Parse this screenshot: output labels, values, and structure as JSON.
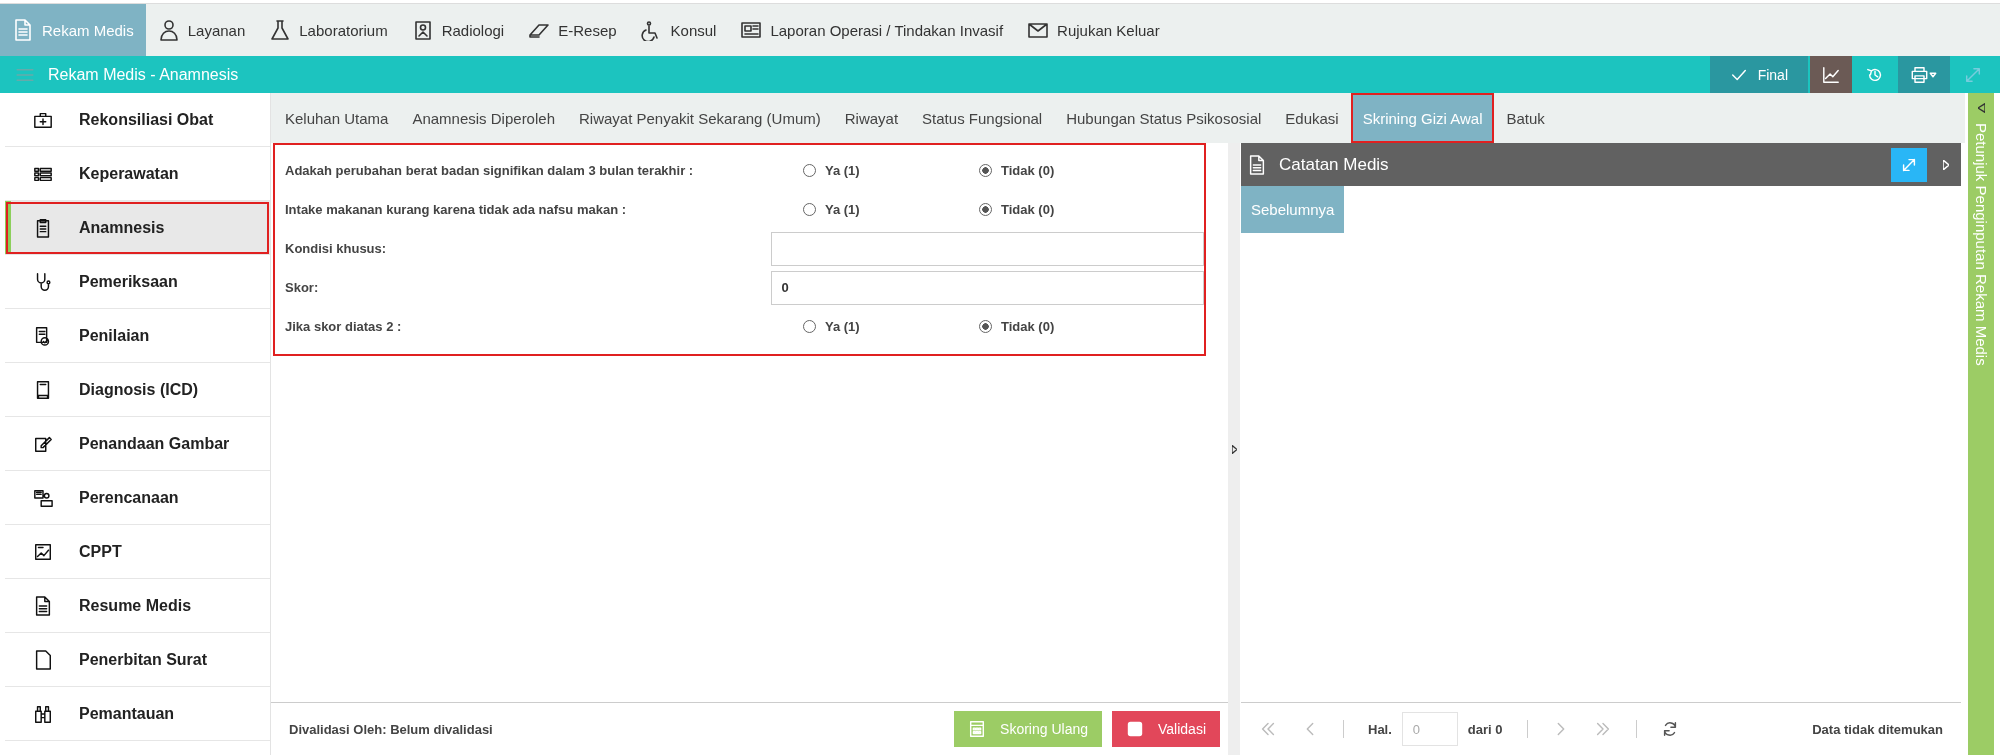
{
  "nav": [
    {
      "label": "Rekam Medis",
      "selected": true
    },
    {
      "label": "Layanan",
      "selected": false
    },
    {
      "label": "Laboratorium",
      "selected": false
    },
    {
      "label": "Radiologi",
      "selected": false
    },
    {
      "label": "E-Resep",
      "selected": false
    },
    {
      "label": "Konsul",
      "selected": false
    },
    {
      "label": "Laporan Operasi / Tindakan Invasif",
      "selected": false
    },
    {
      "label": "Rujukan Keluar",
      "selected": false
    }
  ],
  "header": {
    "title": "Rekam Medis - Anamnesis",
    "final_button": "Final"
  },
  "sidebar": {
    "items": [
      {
        "label": "Rekonsiliasi Obat",
        "selected": false
      },
      {
        "label": "Keperawatan",
        "selected": false
      },
      {
        "label": "Anamnesis",
        "selected": true
      },
      {
        "label": "Pemeriksaan",
        "selected": false
      },
      {
        "label": "Penilaian",
        "selected": false
      },
      {
        "label": "Diagnosis (ICD)",
        "selected": false
      },
      {
        "label": "Penandaan Gambar",
        "selected": false
      },
      {
        "label": "Perencanaan",
        "selected": false
      },
      {
        "label": "CPPT",
        "selected": false
      },
      {
        "label": "Resume Medis",
        "selected": false
      },
      {
        "label": "Penerbitan Surat",
        "selected": false
      },
      {
        "label": "Pemantauan",
        "selected": false
      }
    ]
  },
  "tabs": [
    {
      "label": "Keluhan Utama",
      "selected": false
    },
    {
      "label": "Anamnesis Diperoleh",
      "selected": false
    },
    {
      "label": "Riwayat Penyakit Sekarang (Umum)",
      "selected": false
    },
    {
      "label": "Riwayat",
      "selected": false
    },
    {
      "label": "Status Fungsional",
      "selected": false
    },
    {
      "label": "Hubungan Status Psikososial",
      "selected": false
    },
    {
      "label": "Edukasi",
      "selected": false
    },
    {
      "label": "Skrining Gizi Awal",
      "selected": true
    },
    {
      "label": "Batuk",
      "selected": false
    }
  ],
  "form": {
    "rows": [
      {
        "kind": "radio",
        "label": "Adakah perubahan berat badan signifikan dalam 3 bulan terakhir :",
        "options": [
          {
            "label": "Ya (1)",
            "selected": false
          },
          {
            "label": "Tidak (0)",
            "selected": true
          }
        ]
      },
      {
        "kind": "radio",
        "label": "Intake makanan kurang karena tidak ada nafsu makan :",
        "options": [
          {
            "label": "Ya (1)",
            "selected": false
          },
          {
            "label": "Tidak (0)",
            "selected": true
          }
        ]
      },
      {
        "kind": "text",
        "label": "Kondisi khusus:",
        "value": ""
      },
      {
        "kind": "text",
        "label": "Skor:",
        "value": "0"
      },
      {
        "kind": "radio",
        "label": "Jika skor diatas 2 :",
        "options": [
          {
            "label": "Ya (1)",
            "selected": false
          },
          {
            "label": "Tidak (0)",
            "selected": true
          }
        ]
      }
    ]
  },
  "footer": {
    "status": "Divalidasi Oleh: Belum divalidasi",
    "rescore_button": "Skoring Ulang",
    "validate_button": "Validasi"
  },
  "notes": {
    "title": "Catatan Medis",
    "tabs": [
      {
        "label": "Sebelumnya",
        "selected": true
      }
    ],
    "pager": {
      "page_label": "Hal.",
      "page_value": "0",
      "page_total": "dari 0",
      "status": "Data tidak ditemukan"
    }
  },
  "side_strip": {
    "label": "Petunjuk Penginputan Rekam Medis"
  }
}
